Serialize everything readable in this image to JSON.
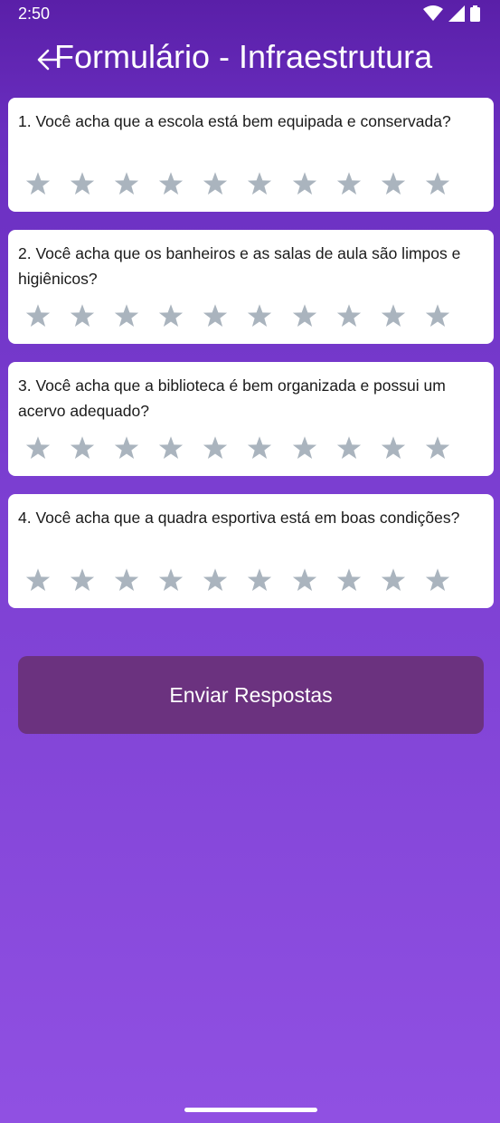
{
  "status_bar": {
    "time": "2:50",
    "icons": [
      "wifi-icon",
      "signal-icon",
      "battery-icon"
    ]
  },
  "app_bar": {
    "back_icon": "arrow-back-icon",
    "title": "Formulário - Infraestrutura"
  },
  "questions": [
    {
      "text": "1. Você acha que a escola está bem equipada e conservada?",
      "rating": 0,
      "max": 10
    },
    {
      "text": "2. Você acha que os banheiros e as salas de aula são limpos e higiênicos?",
      "rating": 0,
      "max": 10
    },
    {
      "text": "3. Você acha que a biblioteca é bem organizada e possui um acervo adequado?",
      "rating": 0,
      "max": 10
    },
    {
      "text": "4. Você acha que a quadra esportiva está em boas condições?",
      "rating": 0,
      "max": 10
    }
  ],
  "submit_label": "Enviar Respostas",
  "colors": {
    "star_empty": "#aab4be",
    "button_bg": "#6b327f",
    "card_bg": "#ffffff"
  }
}
